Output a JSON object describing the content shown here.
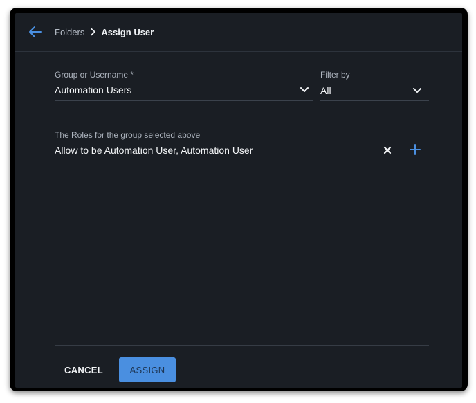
{
  "header": {
    "back_icon": "arrow-left-icon",
    "breadcrumb": {
      "parent": "Folders",
      "separator_icon": "chevron-right-icon",
      "current": "Assign User"
    }
  },
  "form": {
    "group_field": {
      "label": "Group or Username *",
      "value": "Automation Users",
      "icon": "chevron-down-icon"
    },
    "filter_field": {
      "label": "Filter by",
      "value": "All",
      "icon": "chevron-down-icon"
    },
    "roles_field": {
      "label": "The Roles for the group selected above",
      "value": "Allow to be Automation User, Automation User",
      "clear_icon": "close-icon",
      "add_icon": "plus-icon"
    }
  },
  "footer": {
    "cancel_label": "CANCEL",
    "assign_label": "ASSIGN"
  },
  "colors": {
    "background": "#1a1e24",
    "accent": "#4a8fe0",
    "text": "#f3f5f7",
    "muted_text": "#aeb5bf"
  }
}
